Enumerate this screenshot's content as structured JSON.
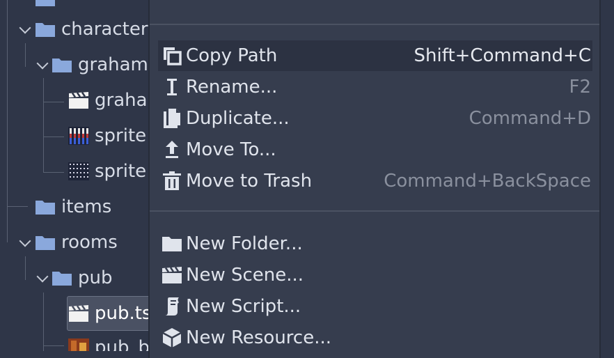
{
  "tree": {
    "items": [
      {
        "label": "characters"
      },
      {
        "label": "graham"
      },
      {
        "label": "graham"
      },
      {
        "label": "sprite"
      },
      {
        "label": "sprite"
      },
      {
        "label": "items"
      },
      {
        "label": "rooms"
      },
      {
        "label": "pub"
      },
      {
        "label": "pub.ts"
      },
      {
        "label": "pub_b"
      }
    ]
  },
  "menu": {
    "items": [
      {
        "label": "Copy Path",
        "shortcut": "Shift+Command+C",
        "icon": "copy-icon"
      },
      {
        "label": "Rename...",
        "shortcut": "F2",
        "icon": "text-cursor-icon"
      },
      {
        "label": "Duplicate...",
        "shortcut": "Command+D",
        "icon": "duplicate-icon"
      },
      {
        "label": "Move To...",
        "shortcut": "",
        "icon": "move-up-icon"
      },
      {
        "label": "Move to Trash",
        "shortcut": "Command+BackSpace",
        "icon": "trash-icon"
      },
      {
        "label": "New Folder...",
        "shortcut": "",
        "icon": "folder-icon"
      },
      {
        "label": "New Scene...",
        "shortcut": "",
        "icon": "clapperboard-icon"
      },
      {
        "label": "New Script...",
        "shortcut": "",
        "icon": "script-icon"
      },
      {
        "label": "New Resource...",
        "shortcut": "",
        "icon": "cube-icon"
      }
    ]
  },
  "colors": {
    "panel_bg": "#2f3648",
    "menu_bg": "#363d4e",
    "hover_bg": "#2c3242",
    "folder": "#8aa8dc",
    "text": "#e0e4ec",
    "shortcut": "#8a909e"
  }
}
